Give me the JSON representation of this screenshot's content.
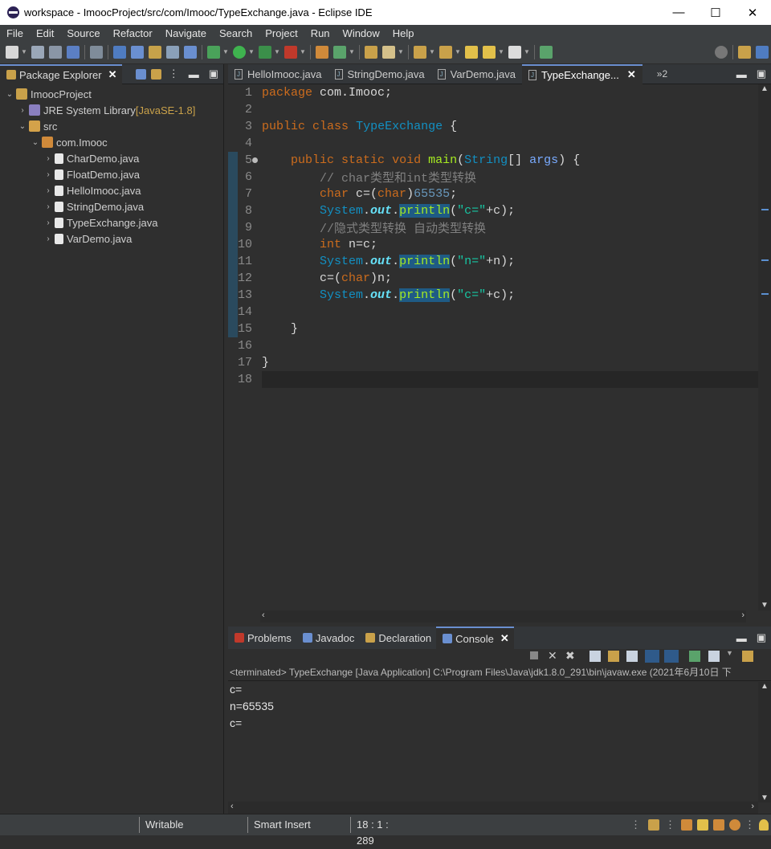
{
  "window": {
    "title": "workspace - ImoocProject/src/com/Imooc/TypeExchange.java - Eclipse IDE",
    "minimize": "—",
    "maximize": "☐",
    "close": "✕"
  },
  "menu": [
    "File",
    "Edit",
    "Source",
    "Refactor",
    "Navigate",
    "Search",
    "Project",
    "Run",
    "Window",
    "Help"
  ],
  "explorer": {
    "title": "Package Explorer",
    "tree": [
      {
        "label": "ImoocProject",
        "suffix": "",
        "indent": 0,
        "arrow": "v",
        "icon": "project-icon"
      },
      {
        "label": "JRE System Library",
        "suffix": " [JavaSE-1.8]",
        "indent": 1,
        "arrow": ">",
        "icon": "library-icon"
      },
      {
        "label": "src",
        "suffix": "",
        "indent": 1,
        "arrow": "v",
        "icon": "source-folder-icon"
      },
      {
        "label": "com.Imooc",
        "suffix": "",
        "indent": 2,
        "arrow": "v",
        "icon": "package-icon"
      },
      {
        "label": "CharDemo.java",
        "suffix": "",
        "indent": 3,
        "arrow": ">",
        "icon": "java-file-icon"
      },
      {
        "label": "FloatDemo.java",
        "suffix": "",
        "indent": 3,
        "arrow": ">",
        "icon": "java-file-icon"
      },
      {
        "label": "HelloImooc.java",
        "suffix": "",
        "indent": 3,
        "arrow": ">",
        "icon": "java-file-icon"
      },
      {
        "label": "StringDemo.java",
        "suffix": "",
        "indent": 3,
        "arrow": ">",
        "icon": "java-file-icon"
      },
      {
        "label": "TypeExchange.java",
        "suffix": "",
        "indent": 3,
        "arrow": ">",
        "icon": "java-file-icon"
      },
      {
        "label": "VarDemo.java",
        "suffix": "",
        "indent": 3,
        "arrow": ">",
        "icon": "java-file-icon"
      }
    ]
  },
  "editor": {
    "tabs": [
      "HelloImooc.java",
      "StringDemo.java",
      "VarDemo.java",
      "TypeExchange..."
    ],
    "active_tab": 3,
    "overflow": "»2",
    "lines": [
      {
        "n": "1",
        "html": "<span class='kw'>package</span> com.Imooc;"
      },
      {
        "n": "2",
        "html": ""
      },
      {
        "n": "3",
        "html": "<span class='kw'>public</span> <span class='kw'>class</span> <span class='cls'>TypeExchange</span> {"
      },
      {
        "n": "4",
        "html": ""
      },
      {
        "n": "5",
        "html": "    <span class='kw'>public</span> <span class='kw'>static</span> <span class='kw'>void</span> <span class='fn'>main</span>(<span class='cls'>String</span>[] <span class='par'>args</span>) {"
      },
      {
        "n": "6",
        "html": "        <span class='cm'>// char类型和int类型转换</span>"
      },
      {
        "n": "7",
        "html": "        <span class='kw'>char</span> c=(<span class='kw'>char</span>)<span class='num'>65535</span>;"
      },
      {
        "n": "8",
        "html": "        <span class='cls'>System</span>.<span class='fld'>out</span>.<span class='meth'>println</span>(<span class='str'>\"c=\"</span>+c);"
      },
      {
        "n": "9",
        "html": "        <span class='cm'>//隐式类型转换 自动类型转换</span>"
      },
      {
        "n": "10",
        "html": "        <span class='kw'>int</span> n=c;"
      },
      {
        "n": "11",
        "html": "        <span class='cls'>System</span>.<span class='fld'>out</span>.<span class='meth'>println</span>(<span class='str'>\"n=\"</span>+n);"
      },
      {
        "n": "12",
        "html": "        c=(<span class='kw'>char</span>)n;"
      },
      {
        "n": "13",
        "html": "        <span class='cls'>System</span>.<span class='fld'>out</span>.<span class='meth'>println</span>(<span class='str'>\"c=\"</span>+c);"
      },
      {
        "n": "14",
        "html": ""
      },
      {
        "n": "15",
        "html": "    }"
      },
      {
        "n": "16",
        "html": ""
      },
      {
        "n": "17",
        "html": "}"
      },
      {
        "n": "18",
        "html": ""
      }
    ]
  },
  "console": {
    "tabs": [
      "Problems",
      "Javadoc",
      "Declaration",
      "Console"
    ],
    "active_tab": 3,
    "status": "<terminated> TypeExchange [Java Application] C:\\Program Files\\Java\\jdk1.8.0_291\\bin\\javaw.exe  (2021年6月10日 下",
    "output": [
      "c=",
      "n=65535",
      "c="
    ]
  },
  "statusbar": {
    "writable": "Writable",
    "insert_mode": "Smart Insert",
    "position": "18 : 1 : 289"
  }
}
